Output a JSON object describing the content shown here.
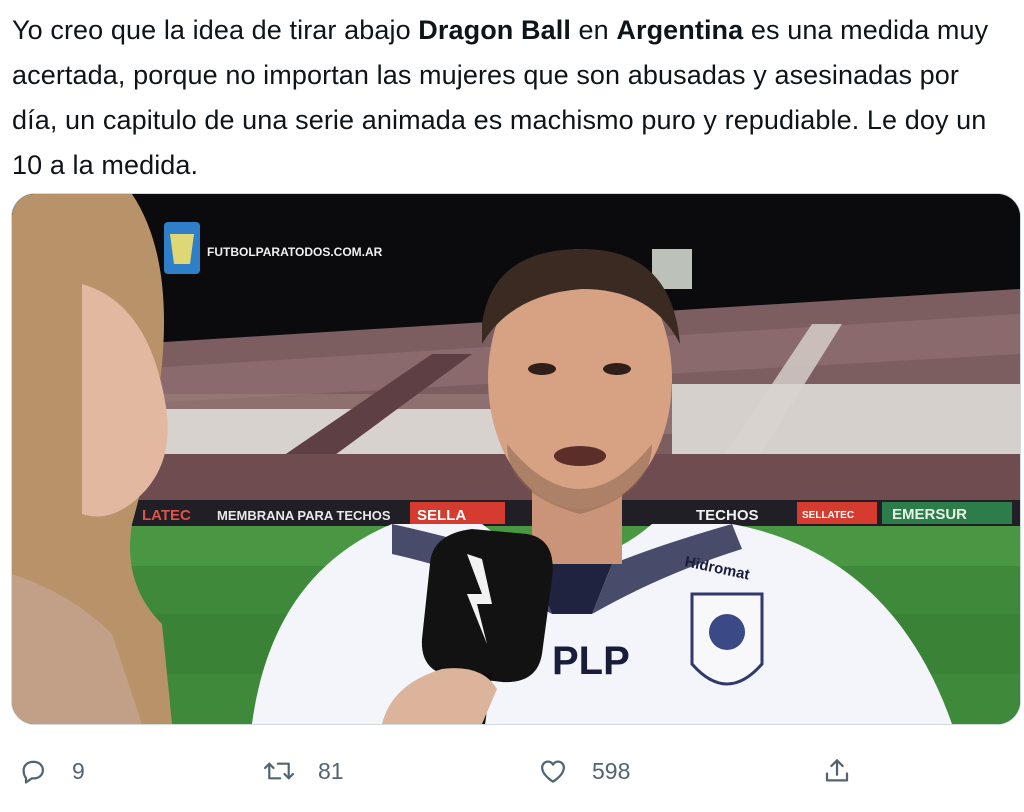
{
  "tweet": {
    "text_1": "Yo creo que la idea de tirar abajo ",
    "bold_1": "Dragon Ball",
    "text_2": " en ",
    "bold_2": "Argentina",
    "text_3": " es una medida muy acertada, porque no importan las mujeres que son abusadas y asesinadas por día, un capitulo de una serie animada es machismo puro y repudiable. Le doy un 10 a la medida."
  },
  "media": {
    "watermark": "FUTBOLPARATODOS.COM.AR",
    "board_1": "LATEC",
    "board_2": "MEMBRANA PARA TECHOS",
    "board_3": "SELLA",
    "board_4": "TECHOS",
    "board_5": "SELLATEC",
    "board_6": "EMERSUR",
    "sponsor_chest": "PLP",
    "sponsor_shoulder": "Hidromat"
  },
  "actions": {
    "reply_count": "9",
    "retweet_count": "81",
    "like_count": "598",
    "icons": [
      "reply-icon",
      "retweet-icon",
      "like-icon",
      "share-icon"
    ],
    "icon_color": "#536471"
  }
}
